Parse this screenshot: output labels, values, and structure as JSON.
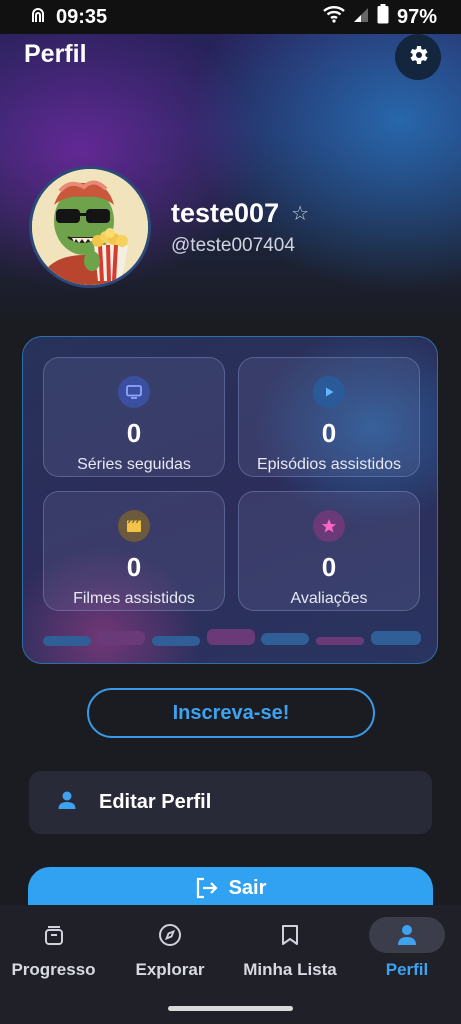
{
  "status_bar": {
    "time": "09:35",
    "battery": "97%"
  },
  "header": {
    "title": "Perfil"
  },
  "profile": {
    "username": "teste007",
    "handle": "@teste007404"
  },
  "stats": {
    "series": {
      "count": "0",
      "label": "Séries seguidas"
    },
    "episodes": {
      "count": "0",
      "label": "Episódios assistidos"
    },
    "movies": {
      "count": "0",
      "label": "Filmes assistidos"
    },
    "ratings": {
      "count": "0",
      "label": "Avaliações"
    }
  },
  "actions": {
    "subscribe_label": "Inscreva-se!",
    "edit_profile_label": "Editar Perfil",
    "logout_label": "Sair"
  },
  "bottom_nav": {
    "progress": "Progresso",
    "explore": "Explorar",
    "my_list": "Minha Lista",
    "profile": "Perfil"
  },
  "colors": {
    "accent": "#3ea2f0",
    "background": "#1b1c21"
  }
}
